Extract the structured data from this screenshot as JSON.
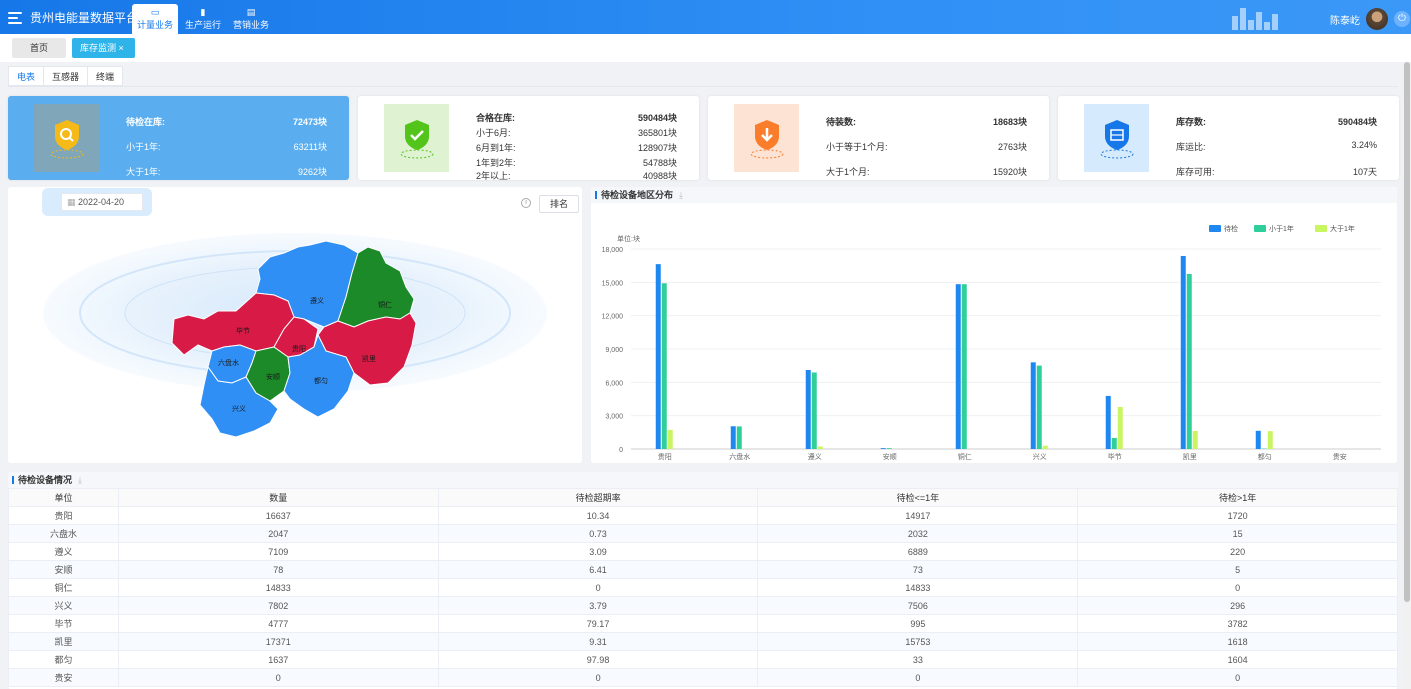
{
  "header": {
    "app_title": "贵州电能量数据平台",
    "nav": [
      {
        "label": "计量业务",
        "icon": "monitor-icon",
        "active": true
      },
      {
        "label": "生产运行",
        "icon": "bar-chart-icon",
        "active": false
      },
      {
        "label": "营销业务",
        "icon": "document-icon",
        "active": false
      }
    ],
    "user_name": "陈泰屹"
  },
  "page_tabs": [
    {
      "label": "首页",
      "active": false
    },
    {
      "label": "库存监测 ×",
      "active": true
    }
  ],
  "sub_tabs": [
    {
      "label": "电表",
      "active": true
    },
    {
      "label": "互感器",
      "active": false
    },
    {
      "label": "终端",
      "active": false
    }
  ],
  "cards": [
    {
      "icon": "search-shield-icon",
      "color": "#f5b918",
      "rows": [
        {
          "label": "待检在库:",
          "value": "72473块",
          "bold": true
        },
        {
          "label": "小于1年:",
          "value": "63211块"
        },
        {
          "label": "大于1年:",
          "value": "9262块"
        }
      ]
    },
    {
      "icon": "check-shield-icon",
      "color": "#52c41a",
      "rows": [
        {
          "label": "合格在库:",
          "value": "590484块",
          "bold": true
        },
        {
          "label": "小于6月:",
          "value": "365801块"
        },
        {
          "label": "6月到1年:",
          "value": "128907块"
        },
        {
          "label": "1年到2年:",
          "value": "54788块"
        },
        {
          "label": "2年以上:",
          "value": "40988块"
        }
      ]
    },
    {
      "icon": "download-shield-icon",
      "color": "#fa7d2b",
      "rows": [
        {
          "label": "待装数:",
          "value": "18683块",
          "bold": true
        },
        {
          "label": "小于等于1个月:",
          "value": "2763块"
        },
        {
          "label": "大于1个月:",
          "value": "15920块"
        }
      ]
    },
    {
      "icon": "inventory-shield-icon",
      "color": "#1677e8",
      "rows": [
        {
          "label": "库存数:",
          "value": "590484块",
          "bold": true
        },
        {
          "label": "库运比:",
          "value": "3.24%"
        },
        {
          "label": "库存可用:",
          "value": "107天"
        }
      ]
    }
  ],
  "map": {
    "date": "2022-04-20",
    "sort_label": "排名",
    "regions": [
      {
        "name": "遵义",
        "color": "#2f8ff5"
      },
      {
        "name": "铜仁",
        "color": "#1d8a2a"
      },
      {
        "name": "毕节",
        "color": "#d81b46"
      },
      {
        "name": "六盘水",
        "color": "#2f8ff5"
      },
      {
        "name": "贵阳",
        "color": "#d81b46"
      },
      {
        "name": "凯里",
        "color": "#d81b46"
      },
      {
        "name": "安顺",
        "color": "#1d8a2a"
      },
      {
        "name": "都匀",
        "color": "#2f8ff5"
      },
      {
        "name": "兴义",
        "color": "#2f8ff5"
      }
    ]
  },
  "chart_panel_title": "待检设备地区分布",
  "chart_data": {
    "type": "bar",
    "ylabel": "单位:块",
    "ylim": [
      0,
      18000
    ],
    "yticks": [
      "0",
      "3,000",
      "6,000",
      "9,000",
      "12,000",
      "15,000",
      "18,000"
    ],
    "categories": [
      "贵阳",
      "六盘水",
      "遵义",
      "安顺",
      "铜仁",
      "兴义",
      "毕节",
      "凯里",
      "都匀",
      "贵安"
    ],
    "legend_position": "top-right",
    "series": [
      {
        "name": "待检",
        "color": "#1e88f0",
        "values": [
          16637,
          2047,
          7109,
          78,
          14833,
          7802,
          4777,
          17371,
          1637,
          0
        ]
      },
      {
        "name": "小于1年",
        "color": "#2ecf9a",
        "values": [
          14917,
          2032,
          6889,
          73,
          14833,
          7506,
          995,
          15753,
          33,
          0
        ]
      },
      {
        "name": "大于1年",
        "color": "#c9f560",
        "values": [
          1720,
          15,
          220,
          5,
          0,
          296,
          3782,
          1618,
          1604,
          0
        ]
      }
    ]
  },
  "table": {
    "title": "待检设备情况",
    "columns": [
      "单位",
      "数量",
      "待检超期率",
      "待检<=1年",
      "待检>1年"
    ],
    "rows": [
      [
        "贵阳",
        "16637",
        "10.34",
        "14917",
        "1720"
      ],
      [
        "六盘水",
        "2047",
        "0.73",
        "2032",
        "15"
      ],
      [
        "遵义",
        "7109",
        "3.09",
        "6889",
        "220"
      ],
      [
        "安顺",
        "78",
        "6.41",
        "73",
        "5"
      ],
      [
        "铜仁",
        "14833",
        "0",
        "14833",
        "0"
      ],
      [
        "兴义",
        "7802",
        "3.79",
        "7506",
        "296"
      ],
      [
        "毕节",
        "4777",
        "79.17",
        "995",
        "3782"
      ],
      [
        "凯里",
        "17371",
        "9.31",
        "15753",
        "1618"
      ],
      [
        "都匀",
        "1637",
        "97.98",
        "33",
        "1604"
      ],
      [
        "贵安",
        "0",
        "0",
        "0",
        "0"
      ]
    ]
  }
}
